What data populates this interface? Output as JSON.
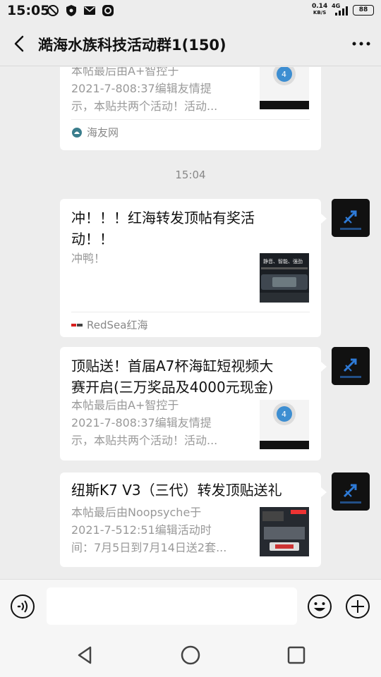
{
  "status_bar": {
    "time": "15:05",
    "net_speed_value": "0.14",
    "net_speed_unit": "KB/S",
    "network": "4G",
    "battery": "88",
    "icons": [
      "do-not-disturb-icon",
      "shield-icon",
      "mail-icon",
      "app-notification-icon",
      "signal-icon",
      "battery-icon"
    ]
  },
  "header": {
    "title": "澔海水族科技活动群1(150)"
  },
  "messages": [
    {
      "title": "",
      "desc": [
        "本帖最后由A+智控于",
        "2021-7-808:37编辑友情提",
        "示，本贴共两个活动！活动..."
      ],
      "source": "海友网"
    },
    {
      "timestamp": "15:04"
    },
    {
      "title": [
        "冲！！！红海转发顶帖有奖活",
        "动！！"
      ],
      "desc": [
        "冲鸭！"
      ],
      "source": "RedSea红海",
      "thumb_text": "静音、智能、强劲"
    },
    {
      "title": [
        "顶贴送！首届A7杯海缸短视频大",
        "赛开启(三万奖品及4000元现金)"
      ],
      "desc": [
        "本帖最后由A+智控于",
        "2021-7-808:37编辑友情提",
        "示，本贴共两个活动！活动..."
      ]
    },
    {
      "title": [
        "纽斯K7 V3（三代）转发顶贴送礼"
      ],
      "desc": [
        "本帖最后由Noopsyche于",
        "2021-7-512:51编辑活动时",
        "间：7月5日到7月14日送2套..."
      ]
    }
  ],
  "input": {
    "placeholder": ""
  },
  "colors": {
    "background": "#ededed",
    "card": "#ffffff",
    "text": "#111111",
    "muted": "#999999"
  }
}
